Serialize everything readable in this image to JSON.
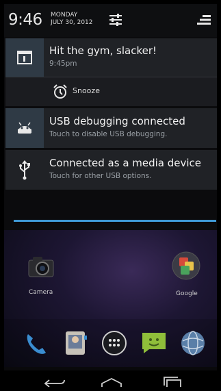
{
  "status": {
    "time": "9:46",
    "day": "MONDAY",
    "date": "JULY 30, 2012"
  },
  "notifications": [
    {
      "title": "Hit the gym, slacker!",
      "subtitle": "9:45pm",
      "icon": "calendar-icon"
    },
    {
      "action_label": "Snooze",
      "icon": "alarm-clock-icon"
    },
    {
      "title": "USB debugging connected",
      "subtitle": "Touch to disable USB debugging.",
      "icon": "android-debug-icon"
    },
    {
      "title": "Connected as a media device",
      "subtitle": "Touch for other USB options.",
      "icon": "usb-icon"
    }
  ],
  "home": {
    "apps": [
      {
        "label": "Camera",
        "icon": "camera-icon"
      },
      {
        "label": "Google",
        "icon": "google-folder-icon"
      }
    ],
    "dock": [
      "phone-icon",
      "contacts-icon",
      "app-drawer-icon",
      "messaging-icon",
      "browser-icon"
    ]
  },
  "colors": {
    "accent": "#3f99d6",
    "card": "#202226",
    "icon_box": "#2f3a45"
  }
}
